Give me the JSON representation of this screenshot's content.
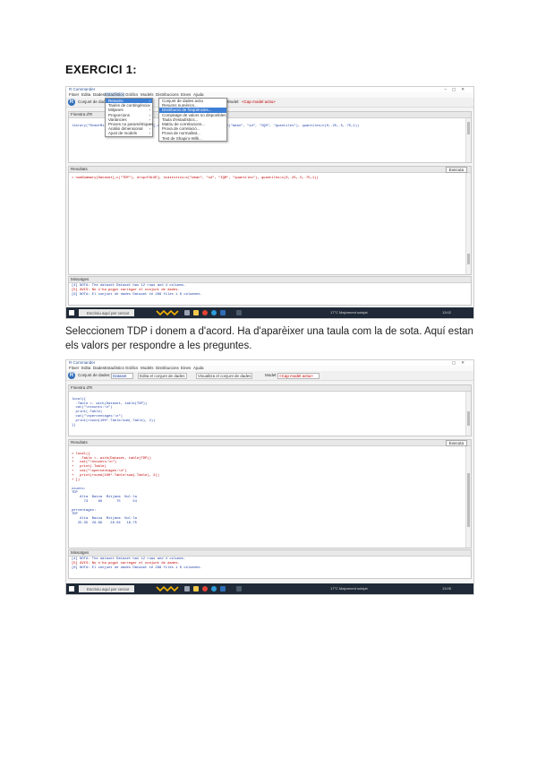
{
  "heading": "EXERCICI 1:",
  "paragraph": "Seleccionem TDP i donem a d'acord. Ha d'aparèixer una taula com la de sota. Aquí estan els valors per respondre a les preguntes.",
  "screenshot1": {
    "window_title": "R Commander",
    "menu": [
      "Fitxer",
      "Edita",
      "Dades",
      "Estadístics",
      "Gràfics",
      "Models",
      "Distribucions",
      "Eines",
      "Ajuda"
    ],
    "dataset_label": "Conjunt de dades:",
    "model_label": "Model:",
    "model_value": "<Cap model actiu>",
    "script_tab": "Finestra d'R",
    "output_label": "Resultats",
    "messages_label": "Missatges",
    "submit_label": "Executa",
    "stats_menu": [
      "Resums",
      "Taules de contingència",
      "Mitjanes",
      "Proporcions",
      "Variàncies",
      "Proves no paramètriques",
      "Anàlisi dimensional",
      "Ajust de models"
    ],
    "summaries_menu": [
      "Conjunt de dades actiu",
      "Resums numèrics...",
      "Distribució de freqüències...",
      "Comptatge de valors no disponibles",
      "Taula d'estadístics...",
      "Matriu de correlacions...",
      "Prova de correlació...",
      "Prova de normalitat...",
      "Test de Shapiro-Wilk..."
    ],
    "script_text": "library(\"RcmdrMisc\"); numSummary(Dataset[,c(\"TDP\"), drop=FALSE], statistics=c(\"mean\", \"sd\", \"IQR\", \"quantiles\"), quantiles=c(0,.25,.5,.75,1))",
    "output_text": "> numSummary(Dataset[,c(\"TDP\"), drop=FALSE], statistics=c(\"mean\", \"sd\", \"IQR\", \"quantiles\"), quantiles=c(0,.25,.5,.75,1))",
    "messages_text": [
      "[4] NOTA: The dataset Dataset has 12 rows and 4 columns.",
      "[5] AVIS: No s'ha pogut carregar el conjunt de dades.",
      "[6] NOTA: El conjunt de dades Dataset té 288 files i 6 columnes."
    ],
    "search_placeholder": "Escriviu aquí per cercar",
    "tray_text": "17°C Majorment solejat",
    "clock": "13:02"
  },
  "screenshot2": {
    "window_title": "R Commander",
    "menu": [
      "Fitxer",
      "Edita",
      "Dades",
      "Estadístics",
      "Gràfics",
      "Models",
      "Distribucions",
      "Eines",
      "Ajuda"
    ],
    "dataset_label": "Conjunt de dades:",
    "dataset_value": "Dataset",
    "edit_button": "Edita el conjunt de dades",
    "view_button": "Visualitza el conjunt de dades",
    "model_label": "Model:",
    "model_value": "<Cap model actiu>",
    "script_tab": "Finestra d'R",
    "script_lines": [
      "local({",
      "  .Table <- with(Dataset, table(TDP))",
      "  cat(\"\\ncounts:\\n\")",
      "  print(.Table)",
      "  cat(\"\\npercentages:\\n\")",
      "  print(round(100*.Table/sum(.Table), 2))",
      "})"
    ],
    "output_label": "Resultats",
    "submit_label": "Executa",
    "output_lines": [
      "> local({",
      "+   .Table <- with(Dataset, table(TDP))",
      "+   cat(\"\\ncounts:\\n\")",
      "+   print(.Table)",
      "+   cat(\"\\npercentages:\\n\")",
      "+   print(round(100*.Table/sum(.Table), 2))",
      "+ })",
      "",
      "counts:",
      "TDP",
      "    Alta  Baixa  Mitjana  Nul·la",
      "      73     86       75      54",
      "",
      "percentages:",
      "TDP",
      "    Alta  Baixa  Mitjana  Nul·la",
      "   25.35  29.86    26.04   18.75"
    ],
    "messages_label": "Missatges",
    "messages_text": [
      "[4] NOTA: The dataset Dataset has 12 rows and 4 columns.",
      "[5] AVIS: No s'ha pogut carregar el conjunt de dades.",
      "[6] NOTA: El conjunt de dades Dataset té 288 files i 6 columnes."
    ],
    "search_placeholder": "Escriviu aquí per cercar",
    "tray_text": "17°C Majorment solejat",
    "clock": "13:05"
  }
}
